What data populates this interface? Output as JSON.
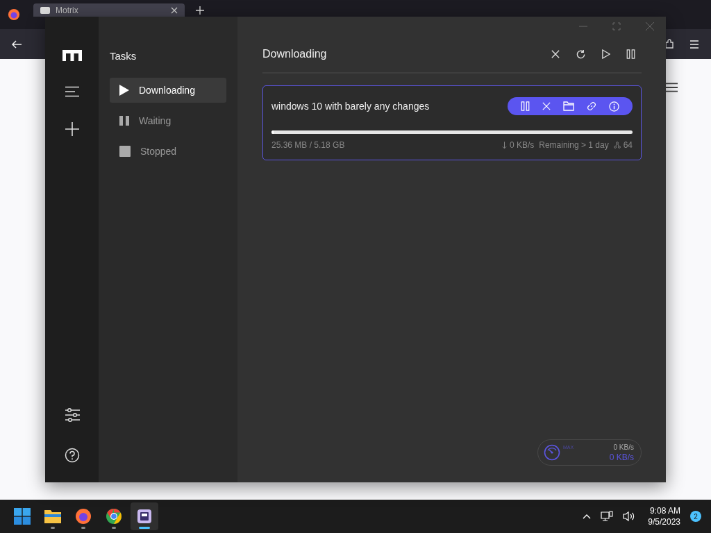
{
  "browser": {
    "tab": {
      "title": "Motrix"
    }
  },
  "app": {
    "sidebar": {
      "title": "Tasks",
      "items": [
        {
          "label": "Downloading",
          "kind": "play",
          "selected": true
        },
        {
          "label": "Waiting",
          "kind": "pause",
          "selected": false
        },
        {
          "label": "Stopped",
          "kind": "stop",
          "selected": false
        }
      ]
    },
    "main": {
      "title": "Downloading",
      "tasks": [
        {
          "name": "windows 10 with barely any changes",
          "level": 0.005,
          "progress": "25.36 MB / 5.18 GB",
          "speed": "0 KB/s",
          "remaining": "Remaining > 1 day",
          "connections": "64"
        }
      ]
    },
    "speedometer": {
      "label": "MAX",
      "upload": "0 KB/s",
      "download": "0 KB/s"
    }
  },
  "taskbar": {
    "apps": [
      {
        "kind": "start",
        "selected": false
      },
      {
        "kind": "files",
        "selected": false
      },
      {
        "kind": "firefox",
        "selected": false
      },
      {
        "kind": "chrome",
        "selected": false
      },
      {
        "kind": "motrix",
        "selected": true
      }
    ],
    "time": "9:08 AM",
    "date": "9/5/2023",
    "notifications": "2"
  }
}
